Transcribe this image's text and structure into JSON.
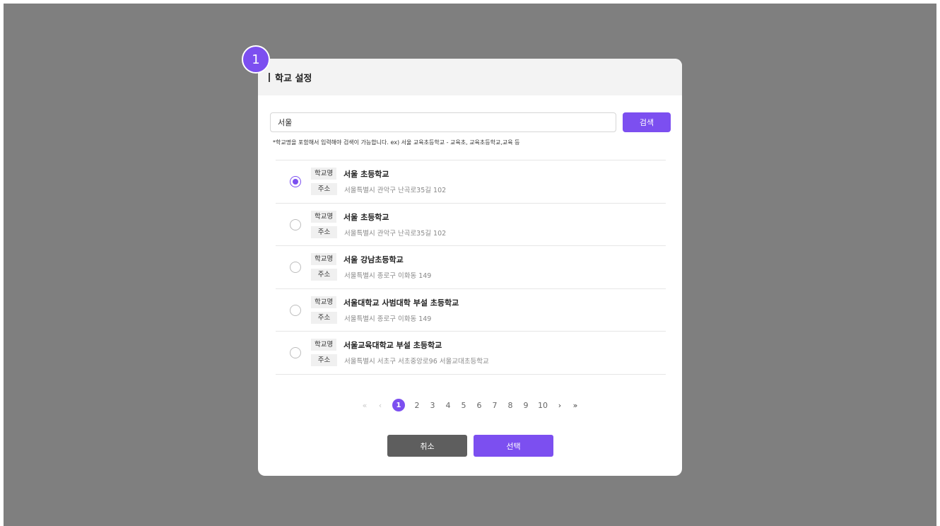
{
  "step_badge": "1",
  "modal": {
    "title": "학교 설정",
    "search": {
      "value": "서울",
      "placeholder": "",
      "button_label": "검색",
      "hint": "*학교명을 포함해서 입력해야 검색이 가능합니다. ex) 서울 교육초등학교 - 교육초, 교육초등학교,교육 등"
    },
    "results": [
      {
        "school_tag": "학교명",
        "name": "서울 초등학교",
        "addr_tag": "주소",
        "address": "서울특별시 관악구 난곡로35길 102",
        "selected": true
      },
      {
        "school_tag": "학교명",
        "name": "서울 초등학교",
        "addr_tag": "주소",
        "address": "서울특별시 관악구 난곡로35길 102",
        "selected": false
      },
      {
        "school_tag": "학교명",
        "name": "서울 강남초등학교",
        "addr_tag": "주소",
        "address": "서울특별시 종로구 이화동 149",
        "selected": false
      },
      {
        "school_tag": "학교명",
        "name": "서울대학교 사범대학 부설 초등학교",
        "addr_tag": "주소",
        "address": "서울특별시 종로구 이화동 149",
        "selected": false
      },
      {
        "school_tag": "학교명",
        "name": "서울교육대학교 부설 초등학교",
        "addr_tag": "주소",
        "address": "서울특별시 서초구 서초중앙로96 서울교대초등학교",
        "selected": false
      }
    ],
    "pagination": {
      "first": "«",
      "prev": "‹",
      "pages": [
        "1",
        "2",
        "3",
        "4",
        "5",
        "6",
        "7",
        "8",
        "9",
        "10"
      ],
      "current": "1",
      "next": "›",
      "last": "»"
    },
    "cancel_label": "취소",
    "select_label": "선택"
  },
  "colors": {
    "accent": "#7c4ff0",
    "backdrop": "#7f7f7f",
    "cancel": "#5e5e5e"
  },
  "icons": {
    "first": "double-chevron-left-icon",
    "prev": "chevron-left-icon",
    "next": "chevron-right-icon",
    "last": "double-chevron-right-icon"
  }
}
